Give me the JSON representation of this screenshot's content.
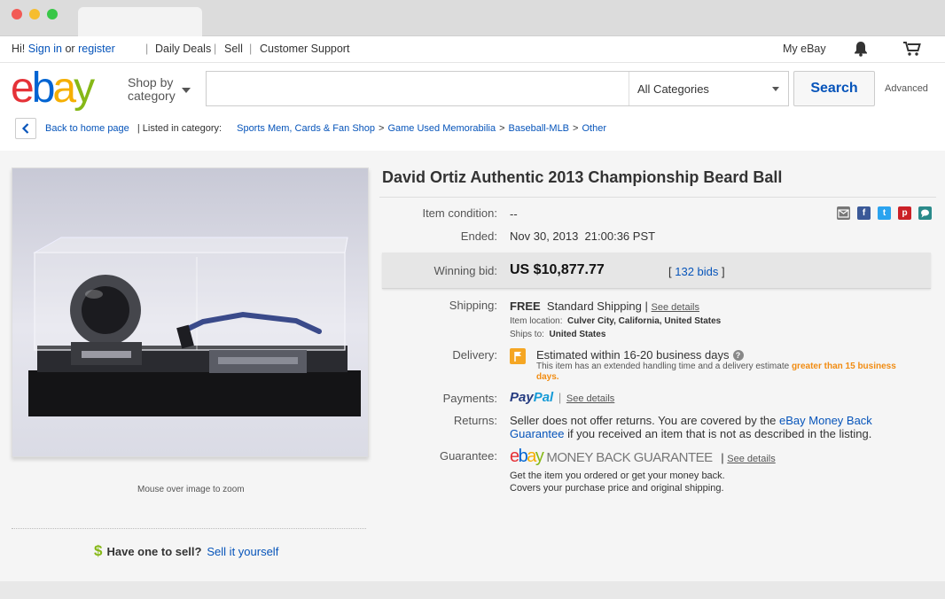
{
  "topnav": {
    "greeting": "Hi!",
    "sign_in": "Sign in",
    "or": "or",
    "register": "register",
    "daily_deals": "Daily Deals",
    "sell": "Sell",
    "customer_support": "Customer Support",
    "my_ebay": "My eBay"
  },
  "header": {
    "logo": [
      "e",
      "b",
      "a",
      "y"
    ],
    "shop_by_line1": "Shop by",
    "shop_by_line2": "category",
    "search_placeholder": "",
    "category_select": "All Categories",
    "search_button": "Search",
    "advanced": "Advanced"
  },
  "breadcrumb": {
    "back": "Back to home page",
    "listed_in": "| Listed in category:",
    "items": [
      "Sports Mem, Cards & Fan Shop",
      "Game Used Memorabilia",
      "Baseball-MLB",
      "Other"
    ]
  },
  "listing": {
    "title": "David Ortiz Authentic 2013 Championship Beard Ball",
    "zoom_note": "Mouse over image to zoom",
    "sell_prompt": "Have one to sell?",
    "sell_link": "Sell it yourself",
    "sell_icon": "$",
    "condition_label": "Item condition:",
    "condition_value": "--",
    "ended_label": "Ended:",
    "ended_value": "Nov 30, 2013  21:00:36 PST",
    "winning_bid_label": "Winning bid:",
    "winning_bid_value": "US $10,877.77",
    "bids_open": "[",
    "bids_link": "132 bids",
    "bids_close": "]",
    "shipping_label": "Shipping:",
    "shipping_free": "FREE",
    "shipping_method": "Standard Shipping",
    "shipping_sep": "|",
    "see_details": "See details",
    "item_location_label": "Item location:",
    "item_location_value": "Culver City, California, United States",
    "ships_to_label": "Ships to:",
    "ships_to_value": "United States",
    "delivery_label": "Delivery:",
    "delivery_estimate": "Estimated within 16-20 business days",
    "delivery_help": "?",
    "delivery_note": "This item has an extended handling time and a delivery estimate",
    "delivery_note_highlight_1": "greater than 15",
    "delivery_note_highlight_2": "business days.",
    "payments_label": "Payments:",
    "paypal_1": "Pay",
    "paypal_2": "Pal",
    "returns_label": "Returns:",
    "returns_text_1": "Seller does not offer returns. You are covered by the",
    "returns_link_1": "eBay Money Back",
    "returns_link_2": "Guarantee",
    "returns_text_2": "if you received an item that is not as described in the listing.",
    "guarantee_label": "Guarantee:",
    "mbg_text": "MONEY BACK GUARANTEE",
    "guarantee_line1": "Get the item you ordered or get your money back.",
    "guarantee_line2": "Covers your purchase price and original shipping."
  },
  "share_icons": [
    "email-icon",
    "facebook-icon",
    "twitter-icon",
    "pinterest-icon",
    "comment-icon"
  ],
  "colors": {
    "ebay_red": "#e53238",
    "ebay_blue": "#0064d2",
    "ebay_yellow": "#f5af02",
    "ebay_green": "#86b817",
    "link": "#0654ba",
    "orange": "#f18c12"
  }
}
